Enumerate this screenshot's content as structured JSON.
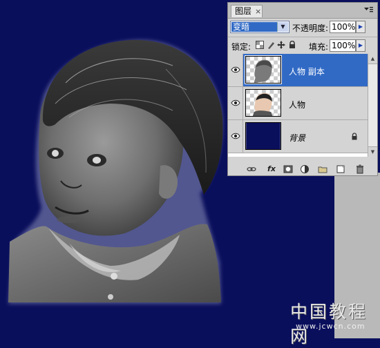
{
  "panel": {
    "tab_label": "图层",
    "tab_close": "×",
    "blend_mode": "变暗",
    "opacity_label": "不透明度:",
    "opacity_value": "100%",
    "lock_label": "锁定:",
    "fill_label": "填充:",
    "fill_value": "100%"
  },
  "layers": [
    {
      "name": "人物 副本",
      "selected": true,
      "visible": true
    },
    {
      "name": "人物",
      "selected": false,
      "visible": true
    },
    {
      "name": "背景",
      "selected": false,
      "visible": true,
      "locked": true
    }
  ],
  "bottom_icons": [
    "link-icon",
    "fx-icon",
    "mask-icon",
    "adjustment-icon",
    "group-icon",
    "new-layer-icon",
    "trash-icon"
  ],
  "watermark": {
    "title": "中国教程网",
    "url": "www.jcwcn.com"
  },
  "colors": {
    "canvas_bg": "#0a0f5c",
    "selection": "#316ac5"
  }
}
